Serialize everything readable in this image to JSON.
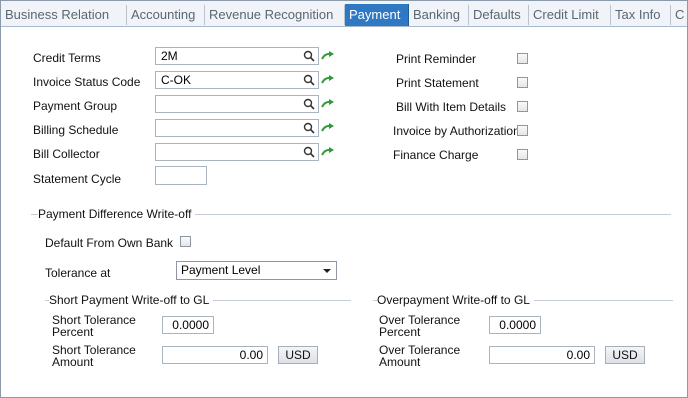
{
  "tabs": [
    {
      "label": "Business Relation"
    },
    {
      "label": "Accounting"
    },
    {
      "label": "Revenue Recognition"
    },
    {
      "label": "Payment"
    },
    {
      "label": "Banking"
    },
    {
      "label": "Defaults"
    },
    {
      "label": "Credit Limit"
    },
    {
      "label": "Tax Info"
    },
    {
      "label": "C"
    }
  ],
  "left_fields": {
    "credit_terms": {
      "label": "Credit Terms",
      "value": "2M"
    },
    "invoice_status_code": {
      "label": "Invoice Status Code",
      "value": "C-OK"
    },
    "payment_group": {
      "label": "Payment Group",
      "value": ""
    },
    "billing_schedule": {
      "label": "Billing Schedule",
      "value": ""
    },
    "bill_collector": {
      "label": "Bill Collector",
      "value": ""
    },
    "statement_cycle": {
      "label": "Statement Cycle",
      "value": ""
    }
  },
  "right_checks": {
    "print_reminder": {
      "label": "Print Reminder",
      "checked": false
    },
    "print_statement": {
      "label": "Print Statement",
      "checked": false
    },
    "bill_with_item_details": {
      "label": "Bill With Item Details",
      "checked": false
    },
    "invoice_by_authorization": {
      "label": "Invoice by Authorization",
      "checked": false
    },
    "finance_charge": {
      "label": "Finance Charge",
      "checked": false
    }
  },
  "writeoff": {
    "title": "Payment Difference Write-off",
    "default_from_own_bank": {
      "label": "Default From Own Bank",
      "checked": false
    },
    "tolerance_at": {
      "label": "Tolerance at",
      "value": "Payment Level"
    },
    "short": {
      "title": "Short Payment Write-off to GL",
      "percent_label_1": "Short Tolerance",
      "percent_label_2": "Percent",
      "percent_value": "0.0000",
      "amount_label_1": "Short Tolerance",
      "amount_label_2": "Amount",
      "amount_value": "0.00",
      "currency": "USD"
    },
    "over": {
      "title": "Overpayment Write-off to GL",
      "percent_label_1": "Over Tolerance",
      "percent_label_2": "Percent",
      "percent_value": "0.0000",
      "amount_label_1": "Over Tolerance",
      "amount_label_2": "Amount",
      "amount_value": "0.00",
      "currency": "USD"
    }
  },
  "icons": {
    "lookup": "magnifier-icon",
    "navigate": "green-arrow-icon"
  },
  "colors": {
    "active_tab": "#2f78c4",
    "arrow": "#2e9a3a"
  }
}
